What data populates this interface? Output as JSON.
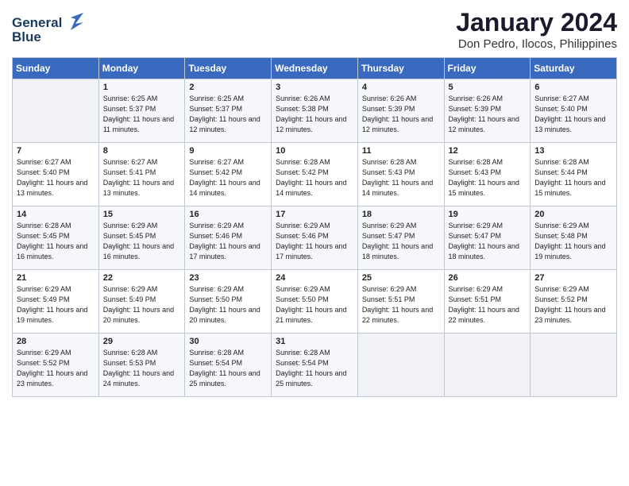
{
  "header": {
    "logo_line1": "General",
    "logo_line2": "Blue",
    "month": "January 2024",
    "location": "Don Pedro, Ilocos, Philippines"
  },
  "weekdays": [
    "Sunday",
    "Monday",
    "Tuesday",
    "Wednesday",
    "Thursday",
    "Friday",
    "Saturday"
  ],
  "weeks": [
    [
      {
        "day": "",
        "sunrise": "",
        "sunset": "",
        "daylight": ""
      },
      {
        "day": "1",
        "sunrise": "Sunrise: 6:25 AM",
        "sunset": "Sunset: 5:37 PM",
        "daylight": "Daylight: 11 hours and 11 minutes."
      },
      {
        "day": "2",
        "sunrise": "Sunrise: 6:25 AM",
        "sunset": "Sunset: 5:37 PM",
        "daylight": "Daylight: 11 hours and 12 minutes."
      },
      {
        "day": "3",
        "sunrise": "Sunrise: 6:26 AM",
        "sunset": "Sunset: 5:38 PM",
        "daylight": "Daylight: 11 hours and 12 minutes."
      },
      {
        "day": "4",
        "sunrise": "Sunrise: 6:26 AM",
        "sunset": "Sunset: 5:39 PM",
        "daylight": "Daylight: 11 hours and 12 minutes."
      },
      {
        "day": "5",
        "sunrise": "Sunrise: 6:26 AM",
        "sunset": "Sunset: 5:39 PM",
        "daylight": "Daylight: 11 hours and 12 minutes."
      },
      {
        "day": "6",
        "sunrise": "Sunrise: 6:27 AM",
        "sunset": "Sunset: 5:40 PM",
        "daylight": "Daylight: 11 hours and 13 minutes."
      }
    ],
    [
      {
        "day": "7",
        "sunrise": "Sunrise: 6:27 AM",
        "sunset": "Sunset: 5:40 PM",
        "daylight": "Daylight: 11 hours and 13 minutes."
      },
      {
        "day": "8",
        "sunrise": "Sunrise: 6:27 AM",
        "sunset": "Sunset: 5:41 PM",
        "daylight": "Daylight: 11 hours and 13 minutes."
      },
      {
        "day": "9",
        "sunrise": "Sunrise: 6:27 AM",
        "sunset": "Sunset: 5:42 PM",
        "daylight": "Daylight: 11 hours and 14 minutes."
      },
      {
        "day": "10",
        "sunrise": "Sunrise: 6:28 AM",
        "sunset": "Sunset: 5:42 PM",
        "daylight": "Daylight: 11 hours and 14 minutes."
      },
      {
        "day": "11",
        "sunrise": "Sunrise: 6:28 AM",
        "sunset": "Sunset: 5:43 PM",
        "daylight": "Daylight: 11 hours and 14 minutes."
      },
      {
        "day": "12",
        "sunrise": "Sunrise: 6:28 AM",
        "sunset": "Sunset: 5:43 PM",
        "daylight": "Daylight: 11 hours and 15 minutes."
      },
      {
        "day": "13",
        "sunrise": "Sunrise: 6:28 AM",
        "sunset": "Sunset: 5:44 PM",
        "daylight": "Daylight: 11 hours and 15 minutes."
      }
    ],
    [
      {
        "day": "14",
        "sunrise": "Sunrise: 6:28 AM",
        "sunset": "Sunset: 5:45 PM",
        "daylight": "Daylight: 11 hours and 16 minutes."
      },
      {
        "day": "15",
        "sunrise": "Sunrise: 6:29 AM",
        "sunset": "Sunset: 5:45 PM",
        "daylight": "Daylight: 11 hours and 16 minutes."
      },
      {
        "day": "16",
        "sunrise": "Sunrise: 6:29 AM",
        "sunset": "Sunset: 5:46 PM",
        "daylight": "Daylight: 11 hours and 17 minutes."
      },
      {
        "day": "17",
        "sunrise": "Sunrise: 6:29 AM",
        "sunset": "Sunset: 5:46 PM",
        "daylight": "Daylight: 11 hours and 17 minutes."
      },
      {
        "day": "18",
        "sunrise": "Sunrise: 6:29 AM",
        "sunset": "Sunset: 5:47 PM",
        "daylight": "Daylight: 11 hours and 18 minutes."
      },
      {
        "day": "19",
        "sunrise": "Sunrise: 6:29 AM",
        "sunset": "Sunset: 5:47 PM",
        "daylight": "Daylight: 11 hours and 18 minutes."
      },
      {
        "day": "20",
        "sunrise": "Sunrise: 6:29 AM",
        "sunset": "Sunset: 5:48 PM",
        "daylight": "Daylight: 11 hours and 19 minutes."
      }
    ],
    [
      {
        "day": "21",
        "sunrise": "Sunrise: 6:29 AM",
        "sunset": "Sunset: 5:49 PM",
        "daylight": "Daylight: 11 hours and 19 minutes."
      },
      {
        "day": "22",
        "sunrise": "Sunrise: 6:29 AM",
        "sunset": "Sunset: 5:49 PM",
        "daylight": "Daylight: 11 hours and 20 minutes."
      },
      {
        "day": "23",
        "sunrise": "Sunrise: 6:29 AM",
        "sunset": "Sunset: 5:50 PM",
        "daylight": "Daylight: 11 hours and 20 minutes."
      },
      {
        "day": "24",
        "sunrise": "Sunrise: 6:29 AM",
        "sunset": "Sunset: 5:50 PM",
        "daylight": "Daylight: 11 hours and 21 minutes."
      },
      {
        "day": "25",
        "sunrise": "Sunrise: 6:29 AM",
        "sunset": "Sunset: 5:51 PM",
        "daylight": "Daylight: 11 hours and 22 minutes."
      },
      {
        "day": "26",
        "sunrise": "Sunrise: 6:29 AM",
        "sunset": "Sunset: 5:51 PM",
        "daylight": "Daylight: 11 hours and 22 minutes."
      },
      {
        "day": "27",
        "sunrise": "Sunrise: 6:29 AM",
        "sunset": "Sunset: 5:52 PM",
        "daylight": "Daylight: 11 hours and 23 minutes."
      }
    ],
    [
      {
        "day": "28",
        "sunrise": "Sunrise: 6:29 AM",
        "sunset": "Sunset: 5:52 PM",
        "daylight": "Daylight: 11 hours and 23 minutes."
      },
      {
        "day": "29",
        "sunrise": "Sunrise: 6:28 AM",
        "sunset": "Sunset: 5:53 PM",
        "daylight": "Daylight: 11 hours and 24 minutes."
      },
      {
        "day": "30",
        "sunrise": "Sunrise: 6:28 AM",
        "sunset": "Sunset: 5:54 PM",
        "daylight": "Daylight: 11 hours and 25 minutes."
      },
      {
        "day": "31",
        "sunrise": "Sunrise: 6:28 AM",
        "sunset": "Sunset: 5:54 PM",
        "daylight": "Daylight: 11 hours and 25 minutes."
      },
      {
        "day": "",
        "sunrise": "",
        "sunset": "",
        "daylight": ""
      },
      {
        "day": "",
        "sunrise": "",
        "sunset": "",
        "daylight": ""
      },
      {
        "day": "",
        "sunrise": "",
        "sunset": "",
        "daylight": ""
      }
    ]
  ]
}
